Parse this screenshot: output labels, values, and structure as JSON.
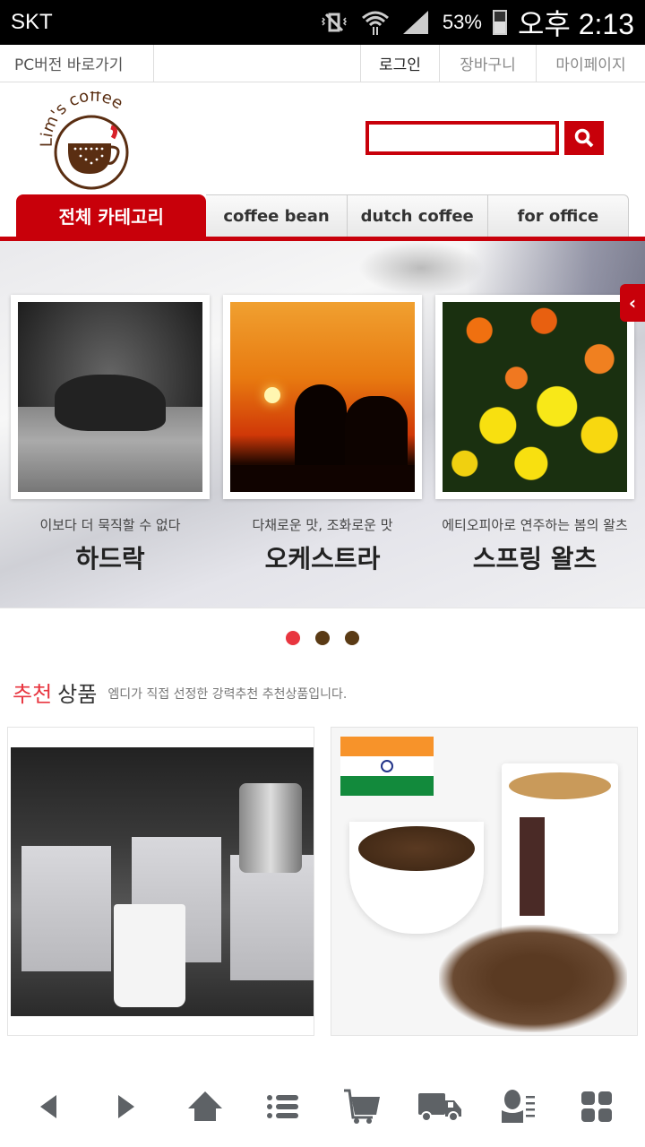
{
  "status_bar": {
    "carrier": "SKT",
    "battery_percent": "53%",
    "time": "오후 2:13",
    "icons": [
      "vibrate-mute-icon",
      "wifi-icon",
      "signal-icon",
      "battery-icon"
    ]
  },
  "top_nav": {
    "pc_version": "PC버전 바로가기",
    "login": "로그인",
    "cart": "장바구니",
    "mypage": "마이페이지"
  },
  "header": {
    "logo_text": "Lim's coffee",
    "search": {
      "value": "",
      "placeholder": ""
    },
    "search_icon": "search-icon"
  },
  "category_tabs": [
    {
      "label": "전체 카테고리",
      "active": true
    },
    {
      "label": "coffee bean",
      "active": false
    },
    {
      "label": "dutch coffee",
      "active": false
    },
    {
      "label": "for office",
      "active": false
    }
  ],
  "banner": {
    "slides": [
      {
        "subtitle": "이보다 더 묵직할 수 없다",
        "title": "하드락",
        "image": "black-and-white buffalo grazing"
      },
      {
        "subtitle": "다채로운 맛, 조화로운 맛",
        "title": "오케스트라",
        "image": "silhouettes at sunset"
      },
      {
        "subtitle": "에티오피아로 연주하는 봄의 왈츠",
        "title": "스프링 왈츠",
        "image": "orange and yellow flowers"
      }
    ],
    "arrow_label": "‹",
    "pagination": {
      "total": 3,
      "active_index": 0
    },
    "colors": {
      "dot_active": "#e8353f",
      "dot_inactive": "#5a3a14"
    }
  },
  "recommended": {
    "title_highlight": "추천",
    "title_rest": "상품",
    "description": "엠디가 직접 선정한 강력추천 추천상품입니다.",
    "products": [
      {
        "image": "drip bag coffee boxes with kettle and mug"
      },
      {
        "image": "India flag with coffee cups and beans"
      }
    ]
  },
  "bottom_bar": [
    {
      "name": "back",
      "icon": "back-arrow-icon"
    },
    {
      "name": "forward",
      "icon": "forward-arrow-icon"
    },
    {
      "name": "home",
      "icon": "home-icon"
    },
    {
      "name": "menu",
      "icon": "list-icon"
    },
    {
      "name": "cart",
      "icon": "cart-icon"
    },
    {
      "name": "delivery",
      "icon": "truck-icon"
    },
    {
      "name": "mypage",
      "icon": "user-icon"
    },
    {
      "name": "more",
      "icon": "grid-icon"
    }
  ],
  "colors": {
    "brand_red": "#c8000a",
    "logo_brown": "#5a2e12"
  }
}
